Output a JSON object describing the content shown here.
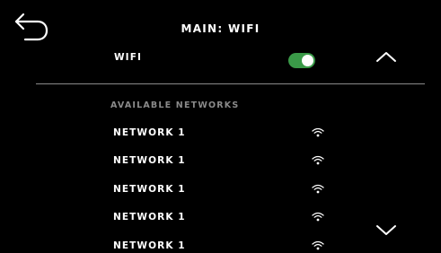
{
  "header": {
    "title": "MAIN: WIFI",
    "back_icon": "back-arrow-icon"
  },
  "wifi": {
    "label": "WIFI",
    "enabled": true,
    "toggle_color": "#3a9a48"
  },
  "networks": {
    "section_label": "AVAILABLE NETWORKS",
    "items": [
      {
        "name": "NETWORK 1",
        "icon": "wifi-signal-icon"
      },
      {
        "name": "NETWORK 1",
        "icon": "wifi-signal-icon"
      },
      {
        "name": "NETWORK 1",
        "icon": "wifi-signal-icon"
      },
      {
        "name": "NETWORK 1",
        "icon": "wifi-signal-icon"
      },
      {
        "name": "NETWORK 1",
        "icon": "wifi-signal-icon"
      }
    ]
  },
  "scroll": {
    "up_icon": "chevron-up-icon",
    "down_icon": "chevron-down-icon"
  },
  "colors": {
    "background": "#000000",
    "text": "#ffffff",
    "muted": "#8a8a8a",
    "toggle_on": "#3a9a48"
  }
}
